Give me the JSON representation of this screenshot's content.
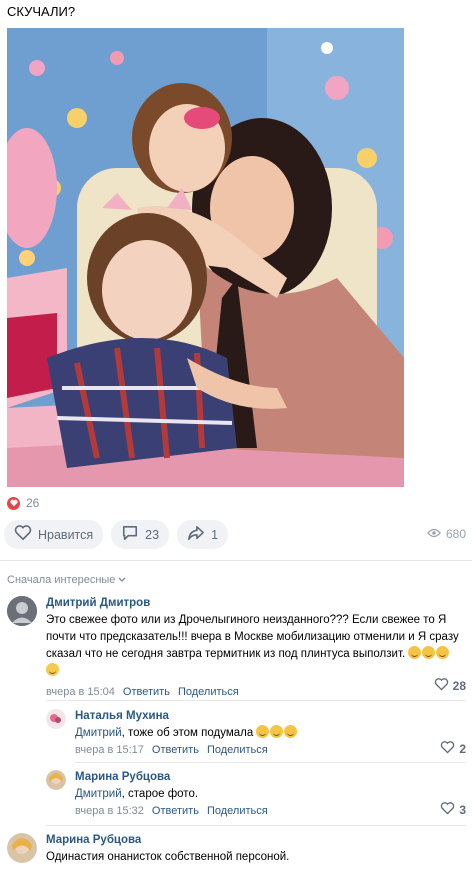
{
  "post": {
    "title": "СКУЧАЛИ?",
    "reactions_count": "26",
    "like_label": "Нравится",
    "comments_count": "23",
    "shares_count": "1",
    "views_count": "680"
  },
  "comments_section": {
    "sort_label": "Сначала интересные",
    "comments": [
      {
        "author": "Дмитрий Дмитров",
        "text": "Это свежее фото или из Дрочелыгиного неизданного??? Если свежее то Я почти что предсказатель!!! вчера в Москве мобилизацию отменили и Я сразу сказал что не сегодня завтра термитник из под плинтуса выползит.",
        "time": "вчера в 15:04",
        "reply": "Ответить",
        "share": "Поделиться",
        "likes": "28"
      },
      {
        "author": "Наталья Мухина",
        "mention": "Дмитрий",
        "text": ", тоже об этом подумала",
        "time": "вчера в 15:17",
        "reply": "Ответить",
        "share": "Поделиться",
        "likes": "2"
      },
      {
        "author": "Марина Рубцова",
        "mention": "Дмитрий",
        "text": ", старое фото.",
        "time": "вчера в 15:32",
        "reply": "Ответить",
        "share": "Поделиться",
        "likes": "3"
      },
      {
        "author": "Марина Рубцова",
        "text": "Одинастия онанисток собственной персоной."
      }
    ]
  },
  "colors": {
    "link": "#2a5885",
    "muted": "#818c99",
    "heart": "#e64646",
    "pill_bg": "#f0f2f5"
  }
}
